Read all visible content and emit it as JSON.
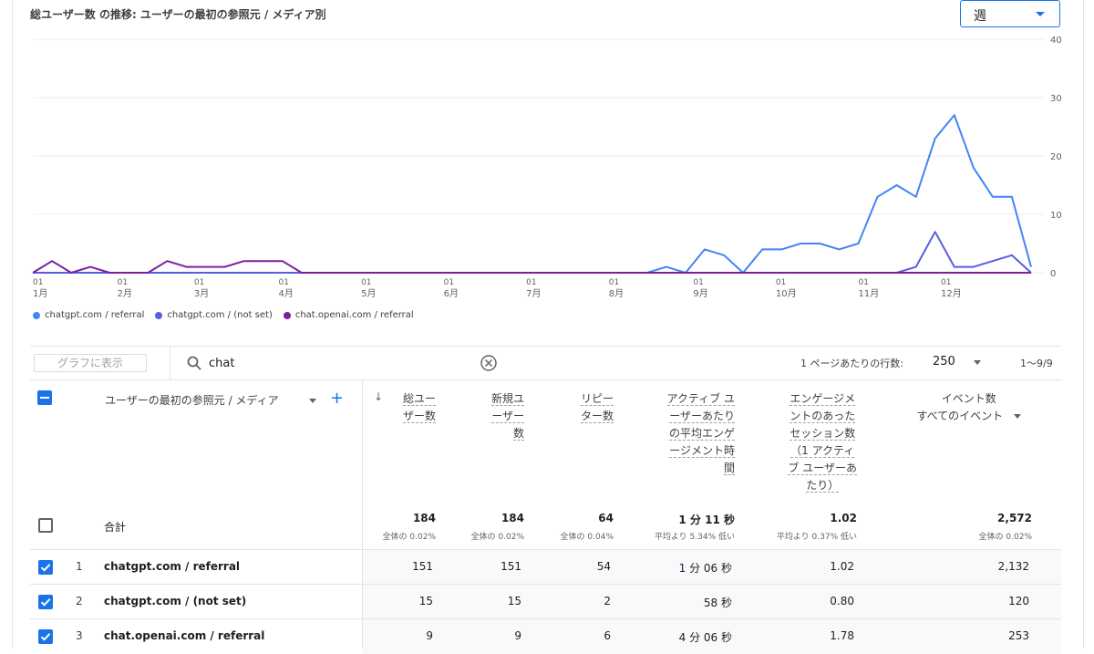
{
  "chart": {
    "title": "総ユーザー数 の推移: ユーザーの最初の参照元 / メディア別",
    "period_value": "週"
  },
  "chart_data": {
    "type": "line",
    "ylim": [
      0,
      40
    ],
    "yticks": [
      "0",
      "10",
      "20",
      "30",
      "40"
    ],
    "xticks": [
      {
        "top": "01",
        "bottom": "1月",
        "index": 0
      },
      {
        "top": "01",
        "bottom": "2月",
        "index": 4.4
      },
      {
        "top": "01",
        "bottom": "3月",
        "index": 8.4
      },
      {
        "top": "01",
        "bottom": "4月",
        "index": 12.8
      },
      {
        "top": "01",
        "bottom": "5月",
        "index": 17.1
      },
      {
        "top": "01",
        "bottom": "6月",
        "index": 21.4
      },
      {
        "top": "01",
        "bottom": "7月",
        "index": 25.7
      },
      {
        "top": "01",
        "bottom": "8月",
        "index": 30
      },
      {
        "top": "01",
        "bottom": "9月",
        "index": 34.4
      },
      {
        "top": "01",
        "bottom": "10月",
        "index": 38.7
      },
      {
        "top": "01",
        "bottom": "11月",
        "index": 43
      },
      {
        "top": "01",
        "bottom": "12月",
        "index": 47.3
      }
    ],
    "series": [
      {
        "name": "chatgpt.com / referral",
        "color": "#4285f4",
        "values": [
          0,
          0,
          0,
          0,
          0,
          0,
          0,
          0,
          0,
          0,
          0,
          0,
          0,
          0,
          0,
          0,
          0,
          0,
          0,
          0,
          0,
          0,
          0,
          0,
          0,
          0,
          0,
          0,
          0,
          0,
          0,
          0,
          0,
          1,
          0,
          4,
          3,
          0,
          4,
          4,
          5,
          5,
          4,
          5,
          13,
          15,
          13,
          23,
          27,
          18,
          13,
          13,
          1
        ]
      },
      {
        "name": "chatgpt.com / (not set)",
        "color": "#5b5ce6",
        "values": [
          0,
          0,
          0,
          0,
          0,
          0,
          0,
          0,
          0,
          0,
          0,
          0,
          0,
          0,
          0,
          0,
          0,
          0,
          0,
          0,
          0,
          0,
          0,
          0,
          0,
          0,
          0,
          0,
          0,
          0,
          0,
          0,
          0,
          0,
          0,
          0,
          0,
          0,
          0,
          0,
          0,
          0,
          0,
          0,
          0,
          0,
          1,
          7,
          1,
          1,
          2,
          3,
          0
        ]
      },
      {
        "name": "chat.openai.com / referral",
        "color": "#7b1fa2",
        "values": [
          0,
          2,
          0,
          1,
          0,
          0,
          0,
          2,
          1,
          1,
          1,
          2,
          2,
          2,
          0,
          0,
          0,
          0,
          0,
          0,
          0,
          0,
          0,
          0,
          0,
          0,
          0,
          0,
          0,
          0,
          0,
          0,
          0,
          0,
          0,
          0,
          0,
          0,
          0,
          0,
          0,
          0,
          0,
          0,
          0,
          0,
          0,
          0,
          0,
          0,
          0,
          0,
          0
        ]
      }
    ]
  },
  "toolbar": {
    "graph_button": "グラフに表示",
    "search_value": "chat",
    "rows_label": "1 ページあたりの行数:",
    "rows_value": "250",
    "range": "1〜9/9"
  },
  "table": {
    "dim_header": "ユーザーの最初の参照元 / メディア",
    "metric_headers": [
      [
        "総ユー",
        "ザー数"
      ],
      [
        "新規ユ",
        "ーザー",
        "数"
      ],
      [
        "リピー",
        "ター数"
      ],
      [
        "アクティブ ユ",
        "ーザーあたり",
        "の平均エンゲ",
        "ージメント時",
        "間"
      ],
      [
        "エンゲージメ",
        "ントのあった",
        "セッション数",
        "（1 アクティ",
        "ブ ユーザーあ",
        "たり）"
      ]
    ],
    "event_header": [
      "イベント数",
      "すべてのイベント"
    ],
    "total": {
      "label": "合計",
      "values": [
        "184",
        "184",
        "64",
        "1 分 11 秒",
        "1.02",
        "2,572"
      ],
      "subs": [
        "全体の 0.02%",
        "全体の 0.02%",
        "全体の 0.04%",
        "平均より 5.34% 低い",
        "平均より 0.37% 低い",
        "全体の 0.02%"
      ]
    },
    "rows": [
      {
        "num": "1",
        "dim": "chatgpt.com / referral",
        "values": [
          "151",
          "151",
          "54",
          "1 分 06 秒",
          "1.02",
          "2,132"
        ]
      },
      {
        "num": "2",
        "dim": "chatgpt.com / (not set)",
        "values": [
          "15",
          "15",
          "2",
          "58 秒",
          "0.80",
          "120"
        ]
      },
      {
        "num": "3",
        "dim": "chat.openai.com / referral",
        "values": [
          "9",
          "9",
          "6",
          "4 分 06 秒",
          "1.78",
          "253"
        ]
      }
    ]
  }
}
